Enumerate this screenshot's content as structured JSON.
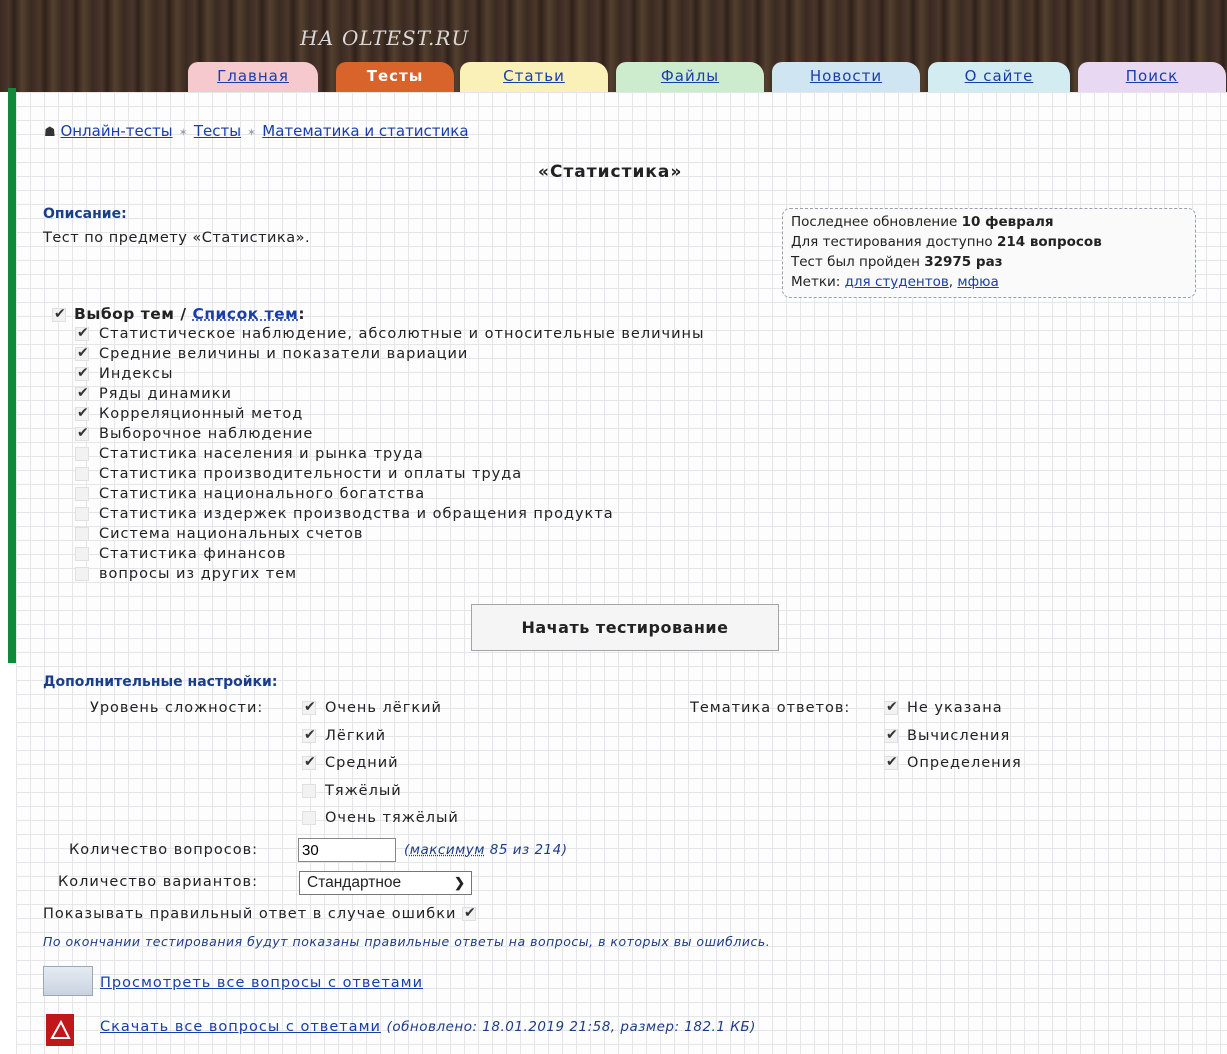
{
  "header": {
    "logo_sub": "НА OLTEST.RU",
    "tabs": [
      {
        "label": "Главная",
        "active": false
      },
      {
        "label": "Тесты",
        "active": true
      },
      {
        "label": "Статьи",
        "active": false
      },
      {
        "label": "Файлы",
        "active": false
      },
      {
        "label": "Новости",
        "active": false
      },
      {
        "label": "О сайте",
        "active": false
      },
      {
        "label": "Поиск",
        "active": false
      }
    ]
  },
  "breadcrumb": [
    "Онлайн-тесты",
    "Тесты",
    "Математика и статистика"
  ],
  "page_title": "«Статистика»",
  "description": {
    "label": "Описание:",
    "text": "Тест по предмету «Статистика»."
  },
  "info": {
    "updated_prefix": "Последнее обновление",
    "updated_value": "10 февраля",
    "available_prefix": "Для тестирования доступно",
    "available_value": "214 вопросов",
    "passed_prefix": "Тест был пройден",
    "passed_value": "32975 раз",
    "tags_label": "Метки:",
    "tags": [
      "для студентов",
      "мфюа"
    ]
  },
  "topics": {
    "select_label": "Выбор тем",
    "separator": "/",
    "list_link": "Список тем",
    "colon": ":",
    "select_all_checked": true,
    "items": [
      {
        "label": "Статистическое наблюдение, абсолютные и относительные величины",
        "checked": true
      },
      {
        "label": "Средние величины и показатели вариации",
        "checked": true
      },
      {
        "label": "Индексы",
        "checked": true
      },
      {
        "label": "Ряды динамики",
        "checked": true
      },
      {
        "label": "Корреляционный метод",
        "checked": true
      },
      {
        "label": "Выборочное наблюдение",
        "checked": true
      },
      {
        "label": "Статистика населения и рынка труда",
        "checked": false
      },
      {
        "label": "Статистика производительности и оплаты труда",
        "checked": false
      },
      {
        "label": "Статистика национального богатства",
        "checked": false
      },
      {
        "label": "Статистика издержек производства и обращения продукта",
        "checked": false
      },
      {
        "label": "Система национальных счетов",
        "checked": false
      },
      {
        "label": "Статистика финансов",
        "checked": false
      },
      {
        "label": "вопросы из других тем",
        "checked": false
      }
    ]
  },
  "start_button": "Начать тестирование",
  "settings": {
    "label": "Дополнительные настройки:",
    "difficulty_label": "Уровень сложности:",
    "difficulty": [
      {
        "label": "Очень лёгкий",
        "checked": true
      },
      {
        "label": "Лёгкий",
        "checked": true
      },
      {
        "label": "Средний",
        "checked": true
      },
      {
        "label": "Тяжёлый",
        "checked": false
      },
      {
        "label": "Очень тяжёлый",
        "checked": false
      }
    ],
    "answers_label": "Тематика ответов:",
    "answers": [
      {
        "label": "Не указана",
        "checked": true
      },
      {
        "label": "Вычисления",
        "checked": true
      },
      {
        "label": "Определения",
        "checked": true
      }
    ],
    "questions_count_label": "Количество вопросов:",
    "questions_count_value": "30",
    "questions_max_prefix": "(",
    "questions_max_link": "максимум",
    "questions_max_suffix": "85 из 214)",
    "variants_label": "Количество вариантов:",
    "variants_value": "Стандартное",
    "show_answer_label": "Показывать правильный ответ в случае ошибки",
    "show_answer_checked": true,
    "note": "По окончании тестирования будут показаны правильные ответы на вопросы, в которых вы ошиблись."
  },
  "links": {
    "view_all": "Просмотреть все вопросы с ответами",
    "download_all": "Скачать все вопросы с ответами",
    "download_meta": "(обновлено: 18.01.2019 21:58, размер: 182.1 КБ)"
  }
}
